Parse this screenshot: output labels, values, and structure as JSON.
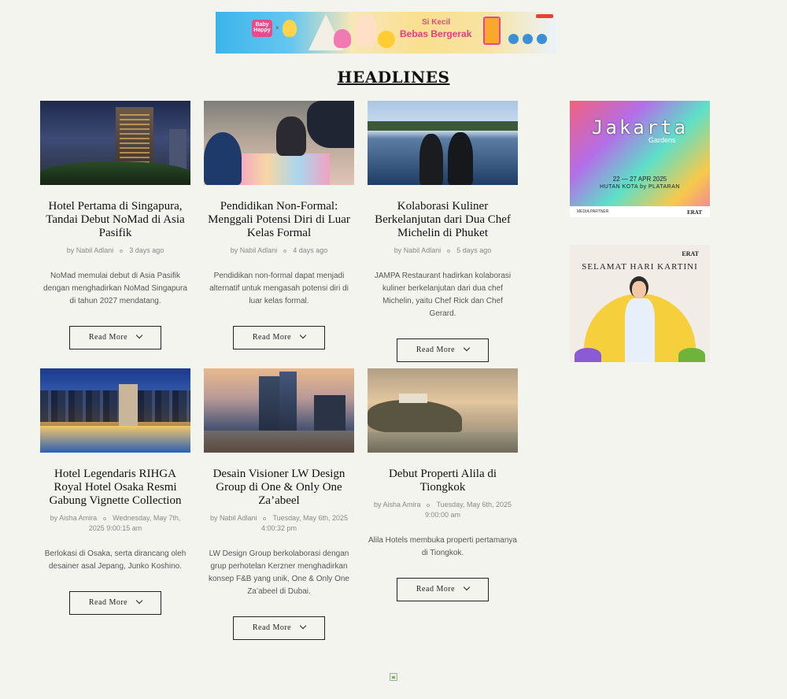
{
  "top_banner": {
    "logo_text": "Baby Happy",
    "tagline_small": "Si Kecil",
    "tagline_big": "Bebas Bergerak"
  },
  "section_title": "HEADLINES",
  "read_more_label": "Read More",
  "articles": [
    {
      "title": "Hotel Pertama di Singapura, Tandai Debut NoMad di Asia Pasifik",
      "author": "by Nabil Adlani",
      "date": "3 days ago",
      "excerpt": "NoMad memulai debut di Asia Pasifik dengan menghadirkan NoMad Singapura di tahun 2027 mendatang."
    },
    {
      "title": "Pendidikan Non-Formal: Menggali Potensi Diri di Luar Kelas Formal",
      "author": "by Nabil Adlani",
      "date": "4 days ago",
      "excerpt": "Pendidikan non-formal dapat menjadi alternatif untuk mengasah potensi diri di luar kelas formal."
    },
    {
      "title": "Kolaborasi Kuliner Berkelanjutan dari Dua Chef Michelin di Phuket",
      "author": "by Nabil Adlani",
      "date": "5 days ago",
      "excerpt": "JAMPA Restaurant hadirkan kolaborasi kuliner berkelanjutan dari dua chef Michelin, yaitu Chef Rick dan Chef Gerard."
    },
    {
      "title": "Hotel Legendaris RIHGA Royal Hotel Osaka Resmi Gabung Vignette Collection",
      "author": "by Aisha Amira",
      "date": "Wednesday, May 7th, 2025 9:00:15 am",
      "excerpt": "Berlokasi di Osaka, serta dirancang oleh desainer asal Jepang, Junko Koshino."
    },
    {
      "title": "Desain Visioner LW Design Group di One & Only One Za’abeel",
      "author": "by Nabil Adlani",
      "date": "Tuesday, May 6th, 2025 4:00:32 pm",
      "excerpt": "LW Design Group berkolaborasi dengan grup perhotelan Kerzner menghadirkan konsep F&B yang unik, One & Only One Za’abeel di Dubai."
    },
    {
      "title": "Debut Properti Alila di Tiongkok",
      "author": "by Aisha Amira",
      "date": "Tuesday, May 6th, 2025 9:00:00 am",
      "excerpt": "Alila Hotels membuka properti pertamanya di Tiongkok."
    }
  ],
  "sidebar_ads": {
    "jakarta": {
      "title": "Jakarta",
      "subtitle": "Gardens",
      "dates": "22 — 27 APR 2025",
      "venue": "HUTAN KOTA by PLATARAN",
      "partner": "MEDIA PARTNER",
      "brand": "ERAT"
    },
    "kartini": {
      "brand": "ERAT",
      "text": "SELAMAT HARI KARTINI"
    }
  }
}
